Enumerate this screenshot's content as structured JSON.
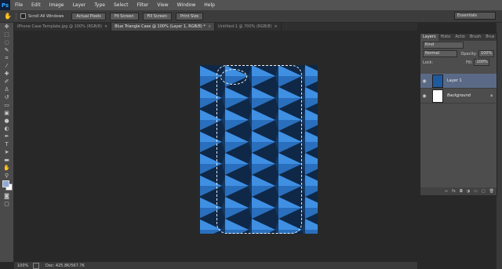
{
  "app": {
    "logo": "Ps"
  },
  "menu": [
    "File",
    "Edit",
    "Image",
    "Layer",
    "Type",
    "Select",
    "Filter",
    "View",
    "Window",
    "Help"
  ],
  "options": {
    "scroll_all_label": "Scroll All Windows",
    "buttons": [
      "Actual Pixels",
      "Fit Screen",
      "Fill Screen",
      "Print Size"
    ],
    "workspace": "Essentials"
  },
  "tabs": [
    {
      "label": "iPhone Case Template.jpg @ 100% (RGB/8)",
      "close": "×"
    },
    {
      "label": "Blue Triangle Case @ 100% (Layer 1, RGB/8) *",
      "close": "×"
    },
    {
      "label": "Untitled-1 @ 700% (RGB/8)",
      "close": "×"
    }
  ],
  "status": {
    "zoom": "100%",
    "doc": "Doc: 425.8K/567.7K"
  },
  "layers_panel": {
    "tabs": [
      "Layers",
      "Histo",
      "Actio",
      "Brush",
      "Brus"
    ],
    "kind": "Kind",
    "blend_mode": "Normal",
    "opacity_label": "Opacity:",
    "opacity_value": "100%",
    "lock_label": "Lock:",
    "fill_label": "Fill:",
    "fill_value": "100%",
    "layers": [
      {
        "name": "Layer 1",
        "selected": true
      },
      {
        "name": "Background",
        "italic": true,
        "locked": true
      }
    ],
    "footer_icons": [
      "link-icon",
      "fx-icon",
      "mask-icon",
      "adjustment-icon",
      "group-icon",
      "new-layer-icon",
      "trash-icon"
    ]
  },
  "colors": {
    "triangle_light": "#3f8fe3",
    "triangle_mid": "#2a6fbd",
    "triangle_dark": "#143a66",
    "canvas_bg": "#0f2847"
  }
}
